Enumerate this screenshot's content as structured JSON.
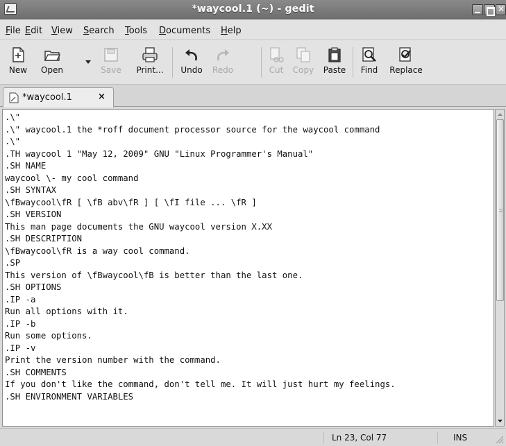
{
  "window": {
    "title": "*waycool.1  (~) - gedit"
  },
  "menubar": {
    "items": [
      {
        "mnemonic": "F",
        "rest": "ile"
      },
      {
        "mnemonic": "E",
        "rest": "dit"
      },
      {
        "mnemonic": "V",
        "rest": "iew"
      },
      {
        "mnemonic": "S",
        "rest": "earch"
      },
      {
        "mnemonic": "T",
        "rest": "ools"
      },
      {
        "mnemonic": "D",
        "rest": "ocuments"
      },
      {
        "mnemonic": "H",
        "rest": "elp"
      }
    ]
  },
  "toolbar": {
    "new_label": "New",
    "open_label": "Open",
    "save_label": "Save",
    "print_label": "Print...",
    "undo_label": "Undo",
    "redo_label": "Redo",
    "cut_label": "Cut",
    "copy_label": "Copy",
    "paste_label": "Paste",
    "find_label": "Find",
    "replace_label": "Replace"
  },
  "tab": {
    "label": "*waycool.1",
    "close_glyph": "×"
  },
  "editor": {
    "lines": [
      ".\\\"",
      ".\\\" waycool.1 the *roff document processor source for the waycool command",
      ".\\\"",
      ".TH waycool 1 \"May 12, 2009\" GNU \"Linux Programmer's Manual\"",
      ".SH NAME",
      "waycool \\- my cool command",
      ".SH SYNTAX",
      "\\fBwaycool\\fR [ \\fB abv\\fR ] [ \\fI file ... \\fR ]",
      ".SH VERSION",
      "This man page documents the GNU waycool version X.XX",
      ".SH DESCRIPTION",
      "\\fBwaycool\\fR is a way cool command.",
      ".SP",
      "This version of \\fBwaycool\\fB is better than the last one.",
      ".SH OPTIONS",
      ".IP -a",
      "Run all options with it.",
      ".IP -b",
      "Run some options.",
      ".IP -v",
      "Print the version number with the command.",
      ".SH COMMENTS",
      "If you don't like the command, don't tell me. It will just hurt my feelings.",
      ".SH ENVIRONMENT VARIABLES"
    ]
  },
  "statusbar": {
    "position": "Ln 23, Col 77",
    "mode": "INS"
  },
  "icons": {
    "title": "gedit-app-icon",
    "new": "new-document-icon",
    "open": "open-folder-icon",
    "save": "save-floppy-icon",
    "print": "printer-icon",
    "undo": "undo-arrow-icon",
    "redo": "redo-arrow-icon",
    "cut": "scissors-icon",
    "copy": "copy-icon",
    "paste": "clipboard-icon",
    "find": "magnifier-icon",
    "replace": "replace-icon"
  }
}
